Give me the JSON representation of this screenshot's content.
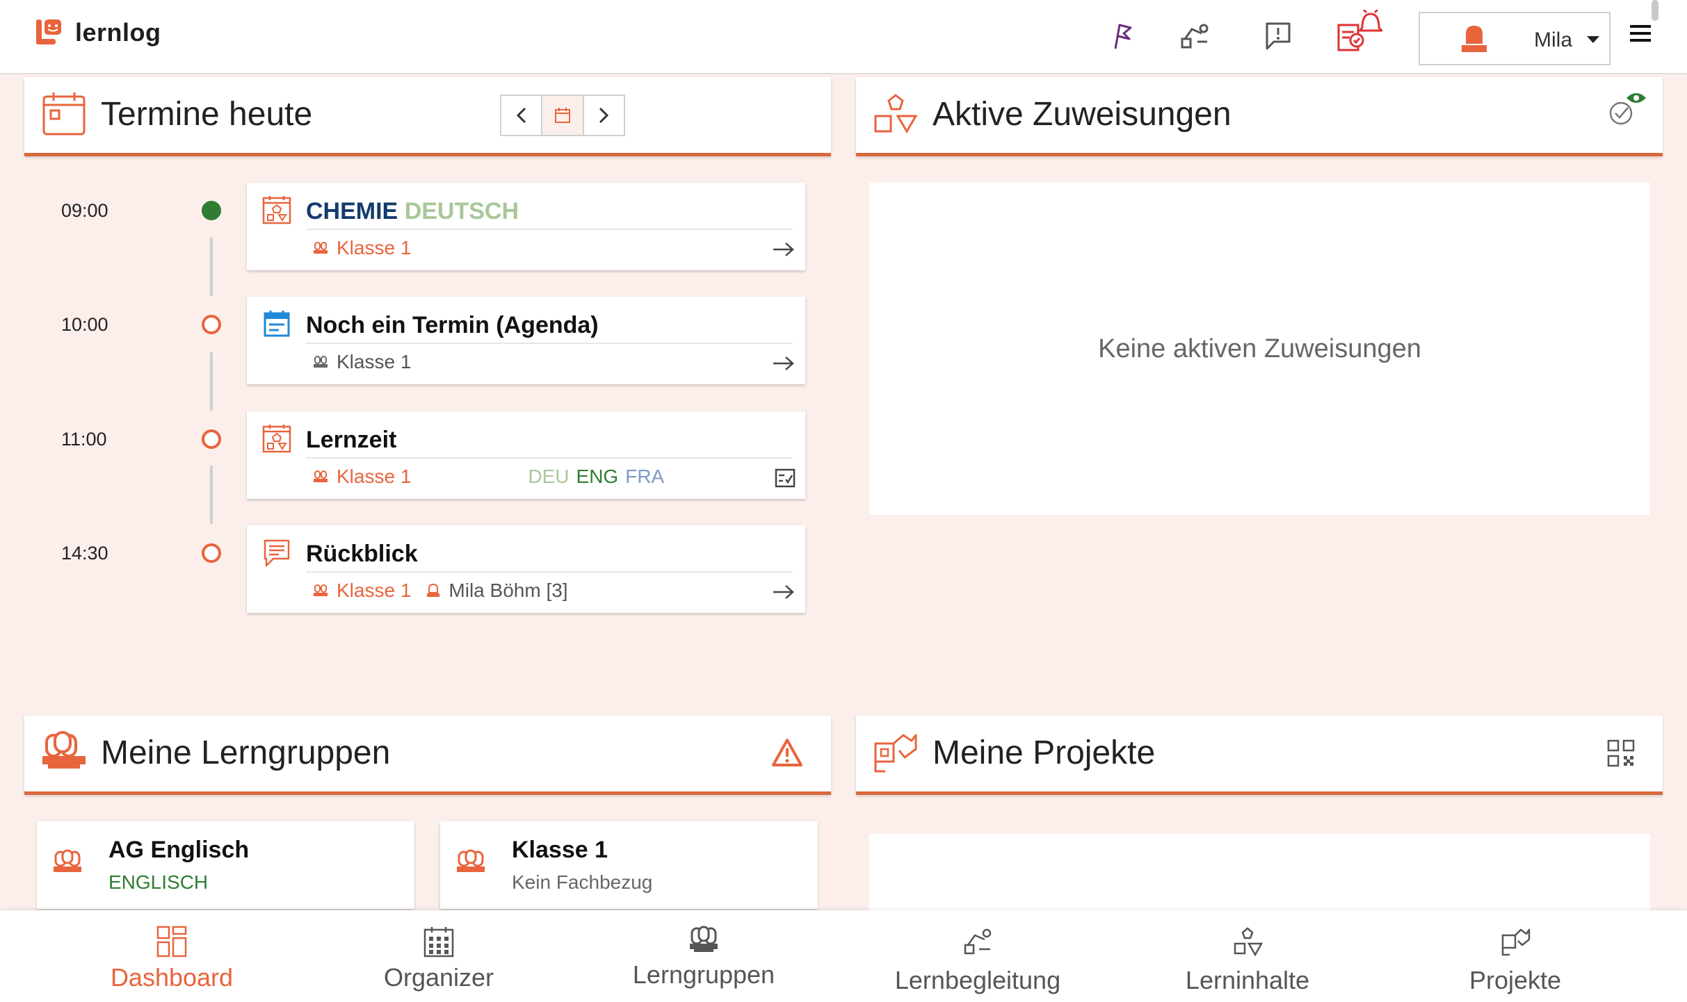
{
  "app": {
    "name": "lernlog",
    "user_name": "Mila"
  },
  "colors": {
    "brand": "#e8643c",
    "accent_line": "#d9683c",
    "background": "#fcefeb",
    "success": "#2e7d32",
    "agenda_blue": "#1f88d8",
    "chemie_blue": "#143a6b",
    "deutsch_green": "#a9c79a",
    "eng_green": "#2e7d32",
    "fra_blue": "#7b99c9"
  },
  "header_icons": [
    "flag-icon",
    "learning-support-icon",
    "feedback-icon",
    "notifications-icon"
  ],
  "termine": {
    "title": "Termine heute",
    "events": [
      {
        "time": "09:00",
        "title_part1": "CHEMIE",
        "title_part2": "DEUTSCH",
        "group": "Klasse 1",
        "icon": "lesson-calendar-icon",
        "status": "current"
      },
      {
        "time": "10:00",
        "title": "Noch ein Termin (Agenda)",
        "group": "Klasse 1",
        "icon": "agenda-calendar-icon",
        "status": "upcoming"
      },
      {
        "time": "11:00",
        "title": "Lernzeit",
        "group": "Klasse 1",
        "subjects": [
          "DEU",
          "ENG",
          "FRA"
        ],
        "icon": "lesson-calendar-icon",
        "status": "upcoming"
      },
      {
        "time": "14:30",
        "title": "Rückblick",
        "group": "Klasse 1",
        "person": "Mila Böhm [3]",
        "icon": "review-chat-icon",
        "status": "upcoming"
      }
    ]
  },
  "zuweisungen": {
    "title": "Aktive Zuweisungen",
    "empty_text": "Keine aktiven Zuweisungen"
  },
  "lerngruppen": {
    "title": "Meine Lerngruppen",
    "groups": [
      {
        "name": "AG Englisch",
        "subject": "ENGLISCH"
      },
      {
        "name": "Klasse 1",
        "subject": "Kein Fachbezug"
      }
    ]
  },
  "projekte": {
    "title": "Meine Projekte"
  },
  "bottom_nav": [
    {
      "label": "Dashboard",
      "icon": "dashboard-icon",
      "active": true
    },
    {
      "label": "Organizer",
      "icon": "organizer-calendar-icon",
      "active": false
    },
    {
      "label": "Lerngruppen",
      "icon": "learning-groups-icon",
      "active": false
    },
    {
      "label": "Lernbegleitung",
      "icon": "learning-support-icon",
      "active": false
    },
    {
      "label": "Lerninhalte",
      "icon": "learning-content-icon",
      "active": false
    },
    {
      "label": "Projekte",
      "icon": "projects-icon",
      "active": false
    }
  ]
}
